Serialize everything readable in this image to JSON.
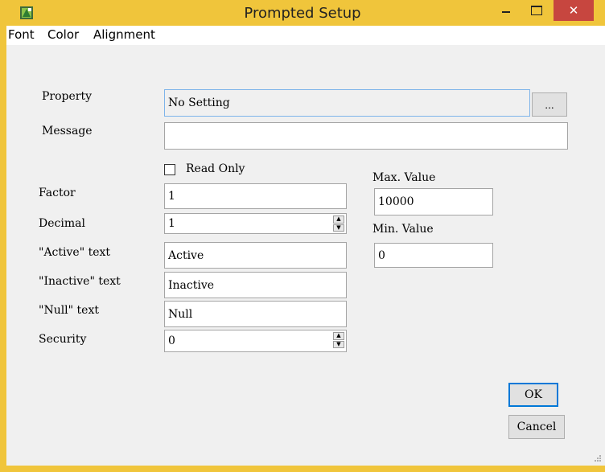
{
  "window": {
    "title": "Prompted Setup",
    "close_glyph": "✕"
  },
  "menu": [
    "Font",
    "Color",
    "Alignment"
  ],
  "form": {
    "property_label": "Property",
    "property_value": "No Setting",
    "browse_label": "...",
    "message_label": "Message",
    "message_value": "",
    "read_only_label": "Read Only",
    "read_only_checked": false,
    "factor_label": "Factor",
    "factor_value": "1",
    "decimal_label": "Decimal",
    "decimal_value": "1",
    "active_label": "\"Active\" text",
    "active_value": "Active",
    "inactive_label": "\"Inactive\" text",
    "inactive_value": "Inactive",
    "null_label": "\"Null\" text",
    "null_value": "Null",
    "security_label": "Security",
    "security_value": "0",
    "max_label": "Max. Value",
    "max_value": "10000",
    "min_label": "Min. Value",
    "min_value": "0"
  },
  "buttons": {
    "ok": "OK",
    "cancel": "Cancel"
  },
  "icons": {
    "app": "app-icon",
    "minimize": "minimize-icon",
    "maximize": "maximize-icon",
    "close": "close-icon",
    "spin_up": "▲",
    "spin_down": "▼"
  },
  "colors": {
    "titlebar": "#f0c53b",
    "close": "#c7463f",
    "client": "#f0f0f0",
    "focus": "#0078d7"
  }
}
